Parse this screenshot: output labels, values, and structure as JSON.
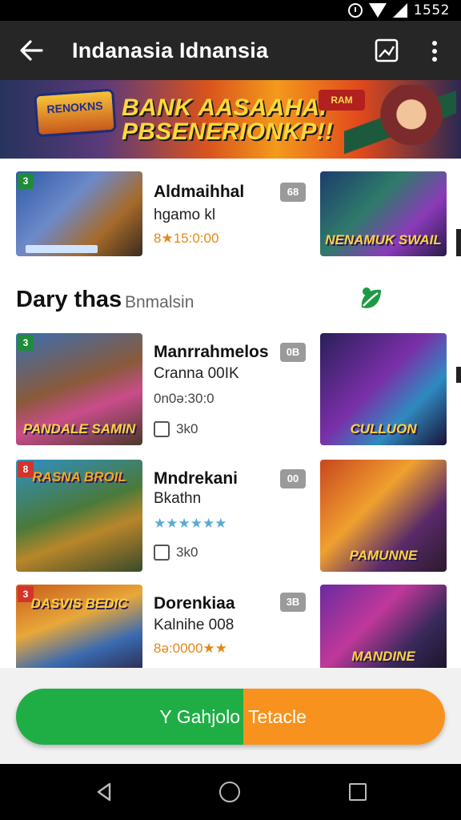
{
  "status_bar": {
    "time": "1552"
  },
  "app_bar": {
    "title": "Indanasia Idnansia"
  },
  "banner": {
    "headline_line1": "BANK AASAAHAI",
    "headline_line2": "PBSENERIONKP!!",
    "badge_text": "RENOKNS",
    "tag_text": "RAM"
  },
  "featured": {
    "title": "Aldmaihhal",
    "subtitle": "hgamo kl",
    "meta": "8★15:0:00",
    "badge": "68",
    "side_thumb_label": "NENAMUK SWAIL"
  },
  "section": {
    "title": "Dary thas",
    "subtitle": "Bnmalsin"
  },
  "items": [
    {
      "title": "Manrrahmelos",
      "subtitle": "Cranna 00IK",
      "meta": "0n0ə:30:0",
      "likes": "3k0",
      "badge": "0B",
      "thumb_label": "PANDALE SAMIN",
      "side_label": "CULLUON",
      "corner": "3"
    },
    {
      "title": "Mndrekani",
      "subtitle": "Bkathn",
      "meta": "★★★★★★",
      "likes": "3k0",
      "badge": "00",
      "thumb_label": "RASNA BROIL",
      "side_label": "PAMUNNE",
      "corner": "8"
    },
    {
      "title": "Dorenkiaa",
      "subtitle": "Kalnihe 008",
      "meta": "8ə:0000★★",
      "likes": "",
      "badge": "3B",
      "thumb_label": "DASVIS BEDIC",
      "side_label": "MANDINE",
      "corner": "3"
    }
  ],
  "cta": {
    "left_text": "Y Gahjolo",
    "right_text": "Tetacle"
  },
  "colors": {
    "green": "#1fae45",
    "orange": "#f7921e",
    "appbar": "#262626"
  }
}
